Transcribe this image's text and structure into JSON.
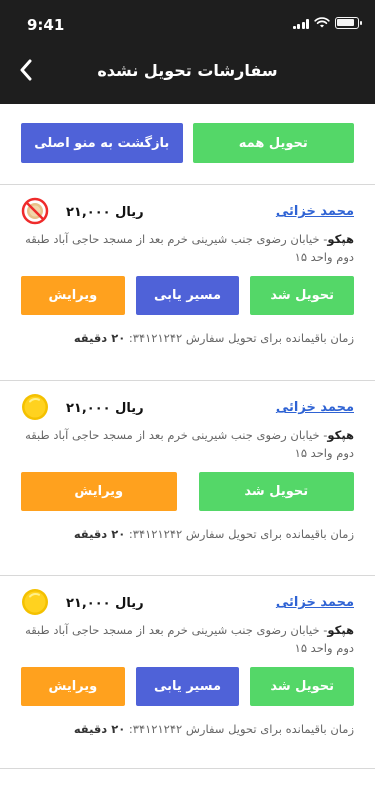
{
  "status": {
    "time": "9:41"
  },
  "header": {
    "title": "سفارشات تحویل نشده"
  },
  "top_buttons": {
    "deliver_all": "تحویل همه",
    "back_menu": "بازگشت به منو اصلی"
  },
  "orders": [
    {
      "name": "محمد خزائی",
      "price": "۲۱,۰۰۰ ریال",
      "address_prefix": "هپکو",
      "address": "- خیابان رضوی جنب شیرینی خرم بعد از مسجد حاجی آباد طبقه دوم واحد ۱۵",
      "buttons": {
        "delivered": "تحویل شد",
        "route": "مسیر یابی",
        "edit": "ویرایش"
      },
      "remaining_label": "زمان باقیمانده برای تحویل سفارش ۳۴۱۲۱۲۴۲:",
      "remaining_value": "۲۰ دقیقه",
      "icon": "no-coin-icon"
    },
    {
      "name": "محمد خزائی",
      "price": "۲۱,۰۰۰ ریال",
      "address_prefix": "هپکو",
      "address": "- خیابان رضوی جنب شیرینی خرم بعد از مسجد حاجی آباد طبقه دوم واحد ۱۵",
      "buttons": {
        "delivered": "تحویل شد",
        "edit": "ویرایش"
      },
      "remaining_label": "زمان باقیمانده برای تحویل سفارش ۳۴۱۲۱۲۴۲:",
      "remaining_value": "۲۰ دقیقه",
      "icon": "coin-icon"
    },
    {
      "name": "محمد خزائی",
      "price": "۲۱,۰۰۰ ریال",
      "address_prefix": "هپکو",
      "address": "- خیابان رضوی جنب شیرینی خرم بعد از مسجد حاجی آباد طبقه دوم واحد ۱۵",
      "buttons": {
        "delivered": "تحویل شد",
        "route": "مسیر یابی",
        "edit": "ویرایش"
      },
      "remaining_label": "زمان باقیمانده برای تحویل سفارش ۳۴۱۲۱۲۴۲:",
      "remaining_value": "۲۰ دقیقه",
      "icon": "coin-icon"
    }
  ],
  "colors": {
    "header_bg": "#1e1e1e",
    "green": "#54d768",
    "blue": "#4f62d8",
    "orange": "#ffa11e",
    "link": "#2f63d4",
    "coin": "#ffd21f"
  }
}
